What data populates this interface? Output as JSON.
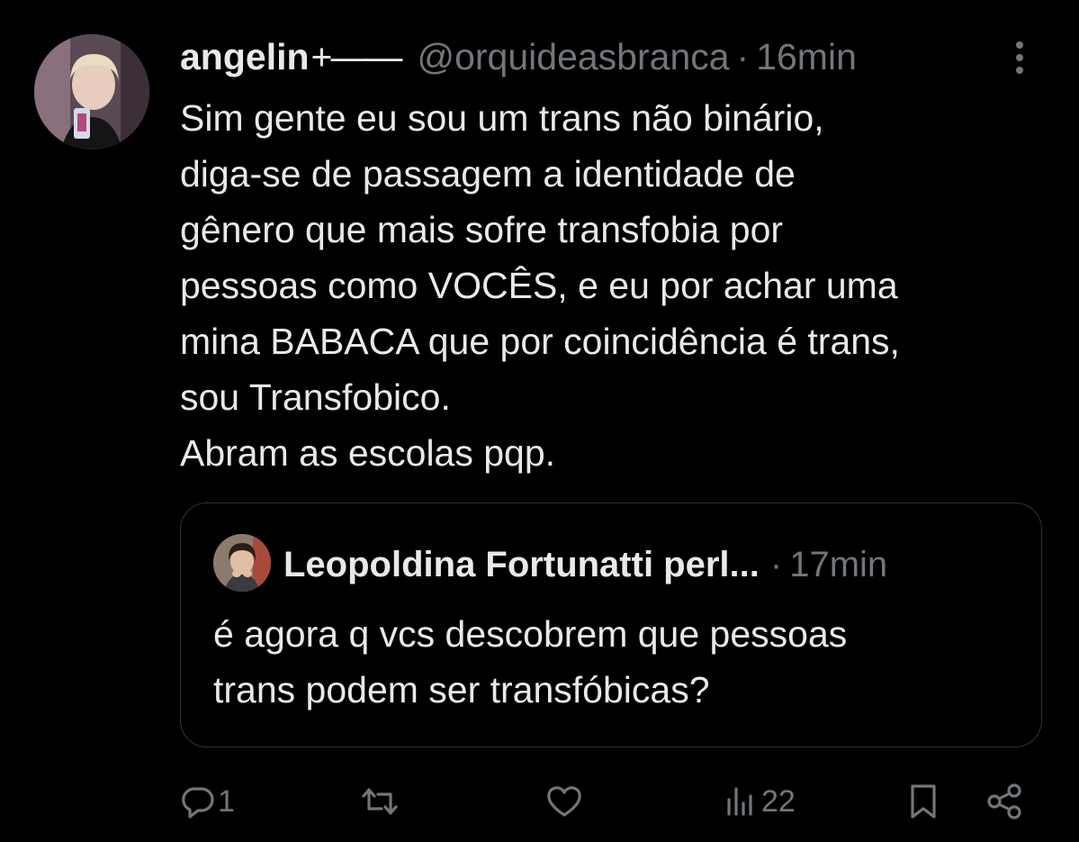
{
  "tweet": {
    "author_name": "angelin",
    "author_decoration": "+——",
    "handle": "@orquideasbranca",
    "separator": "·",
    "time": "16min",
    "text_lines": [
      "Sim gente eu sou um trans não binário,",
      "diga-se de passagem a identidade de",
      "gênero que mais sofre transfobia por",
      "pessoas como VOCÊS, e eu por achar uma",
      "mina BABACA que por coincidência é trans,",
      "sou Transfobico.",
      "Abram as escolas pqp."
    ]
  },
  "quote": {
    "author_name": "Leopoldina Fortunatti perl...",
    "separator": "·",
    "time": "17min",
    "text_lines": [
      "é agora q vcs descobrem que pessoas",
      "trans podem ser transfóbicas?"
    ]
  },
  "actions": {
    "reply_count": "1",
    "views_count": "22"
  },
  "icons": {
    "more": "more-vertical-icon",
    "reply": "reply-icon",
    "retweet": "retweet-icon",
    "like": "heart-icon",
    "views": "views-icon",
    "bookmark": "bookmark-icon",
    "share": "share-icon"
  },
  "colors": {
    "background": "#000000",
    "text": "#e7e9ea",
    "secondary": "#71767b",
    "border": "#2f3336"
  }
}
